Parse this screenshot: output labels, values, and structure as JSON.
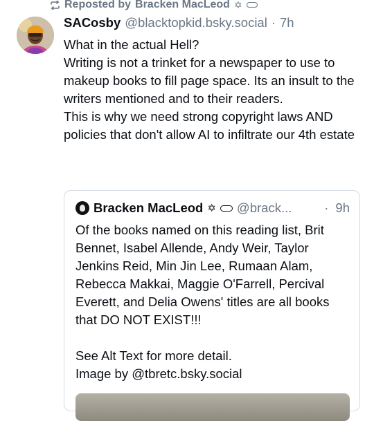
{
  "repost": {
    "prefix": "Reposted by",
    "name": "Bracken MacLeod",
    "glyph": "✡"
  },
  "post": {
    "author_name": "SACosby",
    "author_handle": "@blacktopkid.bsky.social",
    "separator": "·",
    "time": "7h",
    "lines": [
      "What in the actual Hell?",
      "Writing is not a trinket for a newspaper to use to makeup books to fill page space. Its an insult to the writers mentioned and to their readers.",
      "This is why we need strong  copyright laws AND policies that don't allow AI to infiltrate our 4th estate"
    ]
  },
  "quote": {
    "author_name": "Bracken MacLeod",
    "glyph": "✡",
    "author_handle": "@brack...",
    "separator": "·",
    "time": "9h",
    "paragraph_1": "Of the books named on this reading list, Brit Bennet, Isabel Allende, Andy Weir, Taylor Jenkins Reid, Min Jin Lee, Rumaan Alam, Rebecca Makkai, Maggie O'Farrell, Percival Everett, and Delia Owens' titles are all books that DO NOT EXIST!!!",
    "paragraph_2": "See Alt Text for more detail.",
    "paragraph_3": "Image by @tbretc.bsky.social"
  },
  "icons": {
    "repost": "repost-icon",
    "pill": "pill-badge-icon"
  },
  "colors": {
    "muted": "#6a7784",
    "text": "#0b0f14",
    "border": "#d4dbe2"
  }
}
